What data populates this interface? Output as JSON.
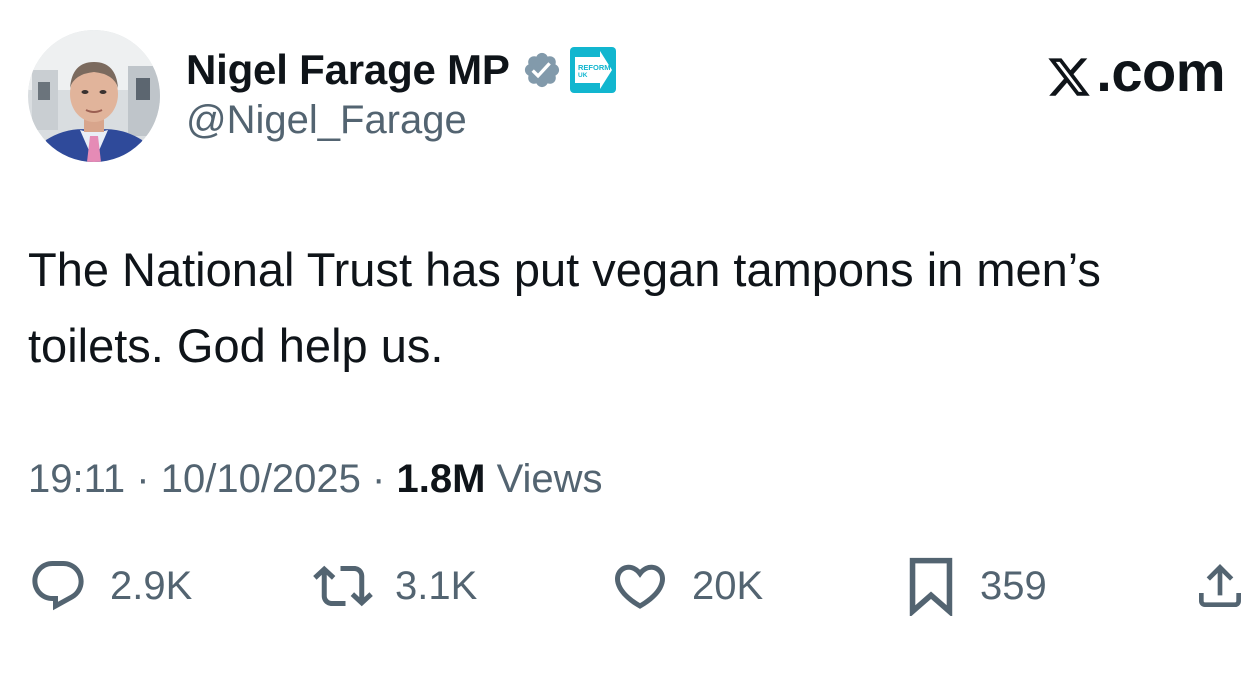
{
  "author": {
    "display_name": "Nigel Farage MP",
    "handle": "@Nigel_Farage",
    "affiliate_badge_text": [
      "REFORM",
      "UK"
    ],
    "verified_color": "#829aab",
    "affiliate_color": "#12b6cf"
  },
  "brand": {
    "label": ".com"
  },
  "tweet": {
    "text": "The National Trust has put vegan tampons in men’s toilets. God help us."
  },
  "meta": {
    "time": "19:11",
    "date": "10/10/2025",
    "separator": "·",
    "views_count": "1.8M",
    "views_label": "Views"
  },
  "actions": {
    "replies": "2.9K",
    "reposts": "3.1K",
    "likes": "20K",
    "bookmarks": "359",
    "icons": [
      "reply-icon",
      "repost-icon",
      "like-icon",
      "bookmark-icon",
      "share-icon"
    ]
  },
  "colors": {
    "primary_text": "#0f1419",
    "secondary_text": "#536471"
  }
}
